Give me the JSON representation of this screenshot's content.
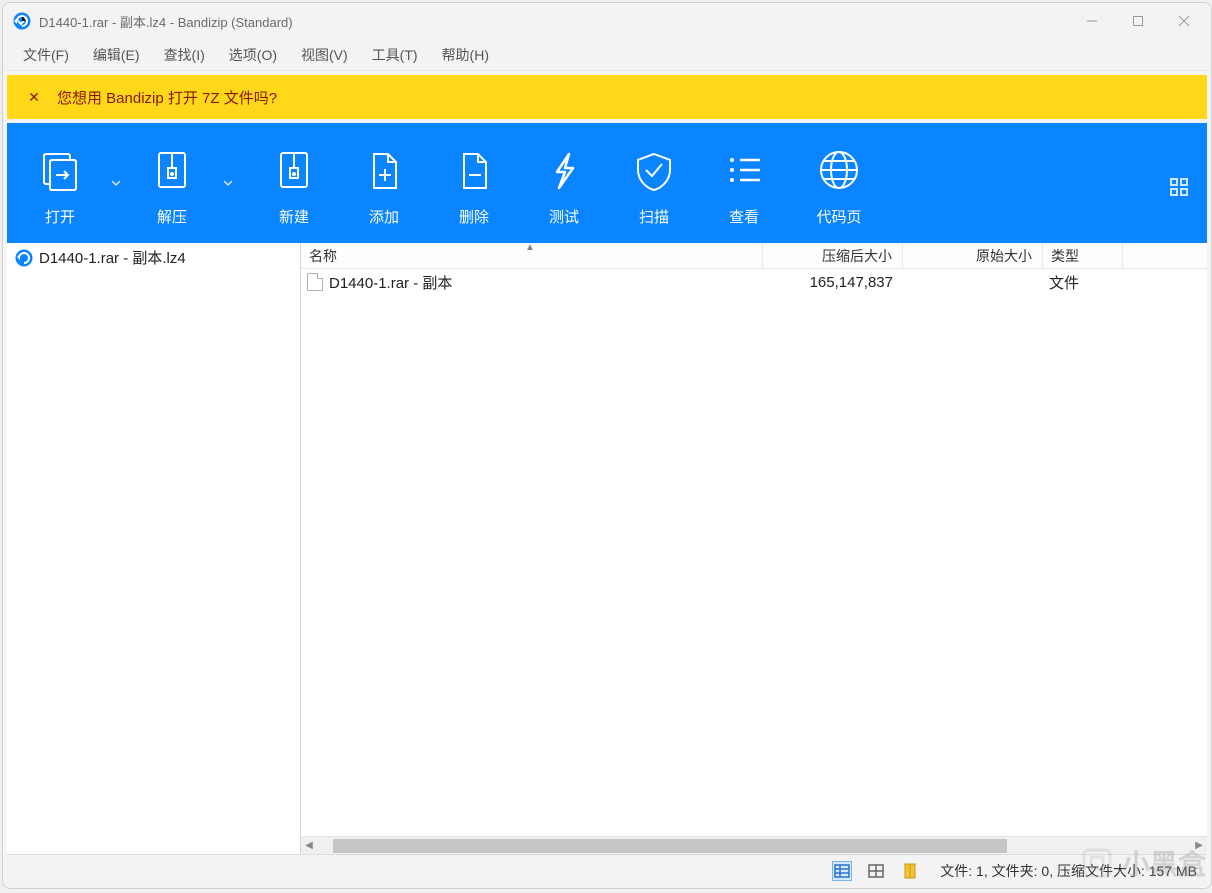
{
  "window": {
    "title": "D1440-1.rar - 副本.lz4 - Bandizip (Standard)"
  },
  "menu": {
    "file": "文件(F)",
    "edit": "编辑(E)",
    "find": "查找(I)",
    "options": "选项(O)",
    "view": "视图(V)",
    "tools": "工具(T)",
    "help": "帮助(H)"
  },
  "notification": {
    "close_symbol": "✕",
    "message": "您想用 Bandizip 打开 7Z 文件吗?"
  },
  "toolbar": {
    "open": "打开",
    "extract": "解压",
    "new": "新建",
    "add": "添加",
    "delete": "删除",
    "test": "测试",
    "scan": "扫描",
    "view": "查看",
    "codepage": "代码页"
  },
  "tree": {
    "root": "D1440-1.rar - 副本.lz4"
  },
  "columns": {
    "name": "名称",
    "compressed": "压缩后大小",
    "original": "原始大小",
    "type": "类型"
  },
  "rows": [
    {
      "name": "D1440-1.rar - 副本",
      "compressed": "165,147,837",
      "original": "",
      "type": "文件"
    }
  ],
  "status": {
    "text": "文件: 1, 文件夹: 0, 压缩文件大小: 157 MB"
  },
  "watermark": {
    "text": "小黑盒"
  }
}
